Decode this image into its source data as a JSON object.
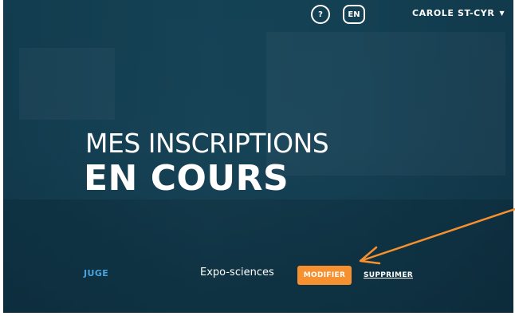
{
  "header": {
    "help_label": "?",
    "lang_label": "EN",
    "user_name": "CAROLE ST-CYR",
    "user_caret": "▼"
  },
  "hero": {
    "title_line1": "MES INSCRIPTIONS",
    "title_line2": "EN COURS"
  },
  "registration": {
    "role": "JUGE",
    "event": "Expo-sciences",
    "modify_label": "MODIFIER",
    "delete_label": "SUPPRIMER"
  },
  "colors": {
    "background": "#1a475b",
    "accent_orange": "#f7902f",
    "role_blue": "#4aa3df",
    "annotation_arrow": "#f7902f"
  }
}
